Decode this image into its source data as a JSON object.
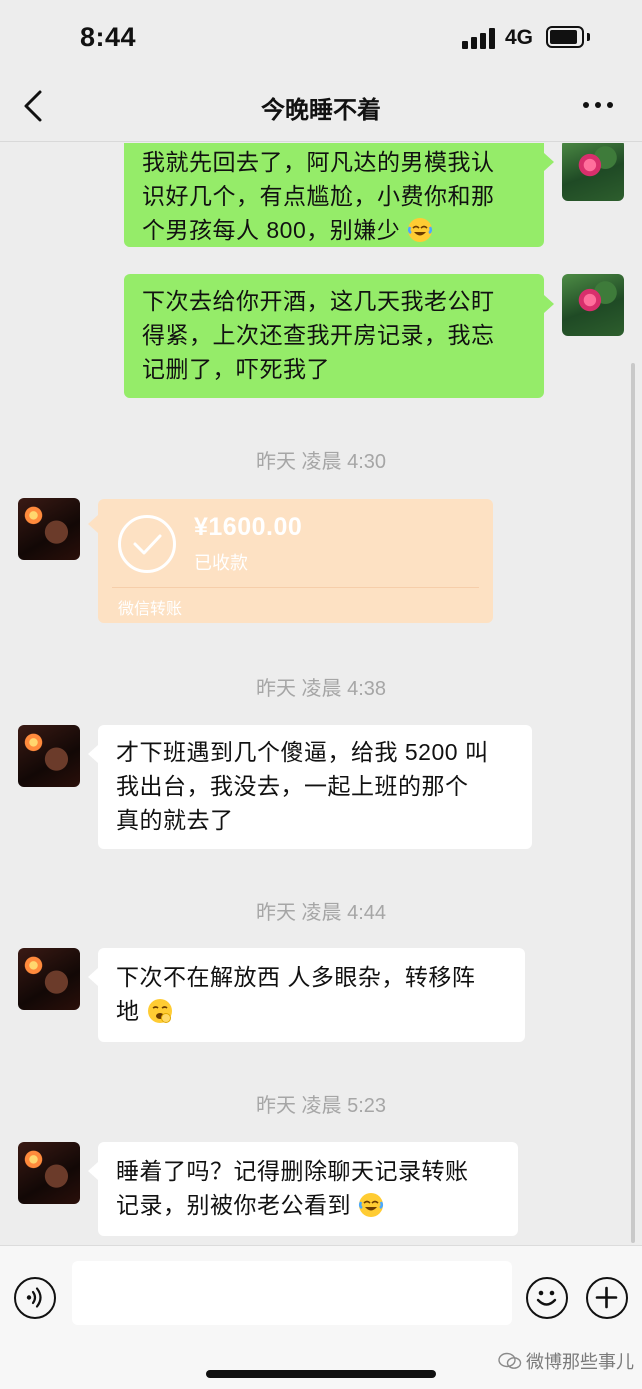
{
  "status_bar": {
    "time": "8:44",
    "network": "4G"
  },
  "nav": {
    "title": "今晚睡不着"
  },
  "messages": [
    {
      "type": "text",
      "side": "out",
      "text": "我就先回去了，阿凡达的男模我认识好几个，有点尴尬，小费你和那个男孩每人 800，别嫌少"
    },
    {
      "type": "text",
      "side": "out",
      "text": "下次去给你开酒，这几天我老公盯得紧，上次还查我开房记录，我忘记删了，吓死我了"
    },
    {
      "type": "time",
      "text": "昨天 凌晨 4:30"
    },
    {
      "type": "transfer",
      "side": "in",
      "amount": "¥1600.00",
      "status": "已收款",
      "label": "微信转账"
    },
    {
      "type": "time",
      "text": "昨天 凌晨 4:38"
    },
    {
      "type": "text",
      "side": "in",
      "text": "才下班遇到几个傻逼，给我 5200 叫我出台，我没去，一起上班的那个真的就去了"
    },
    {
      "type": "time",
      "text": "昨天 凌晨 4:44"
    },
    {
      "type": "text",
      "side": "in",
      "text": "下次不在解放西 人多眼杂，转移阵地"
    },
    {
      "type": "time",
      "text": "昨天 凌晨 5:23"
    },
    {
      "type": "text",
      "side": "in",
      "text": "睡着了吗？记得删除聊天记录转账记录，别被你老公看到"
    }
  ],
  "bubble_lines": {
    "m0": [
      "我就先回去了，阿凡达的男模我认",
      "识好几个，有点尴尬，小费你和那",
      "个男孩每人 800，别嫌少"
    ],
    "m1": [
      "下次去给你开酒，这几天我老公盯",
      "得紧，上次还查我开房记录，我忘",
      "记删了，吓死我了"
    ],
    "m5": [
      "才下班遇到几个傻逼，给我 5200 叫",
      "我出台，我没去，一起上班的那个",
      "真的就去了"
    ],
    "m7": [
      "下次不在解放西 人多眼杂，转移阵",
      "地"
    ],
    "m9": [
      "睡着了吗？记得删除聊天记录转账",
      "记录，别被你老公看到"
    ]
  },
  "input": {
    "placeholder": ""
  },
  "watermark": "微博那些事儿",
  "colors": {
    "background": "#ededed",
    "outgoing_bubble": "#95ec69",
    "incoming_bubble": "#ffffff",
    "transfer_card": "#fde1c3"
  },
  "icons": [
    "back-chevron-icon",
    "more-dots-icon",
    "signal-icon",
    "battery-icon",
    "check-circle-icon",
    "voice-icon",
    "emoji-icon",
    "plus-icon",
    "laughing-crying-emoji",
    "yawning-emoji"
  ]
}
